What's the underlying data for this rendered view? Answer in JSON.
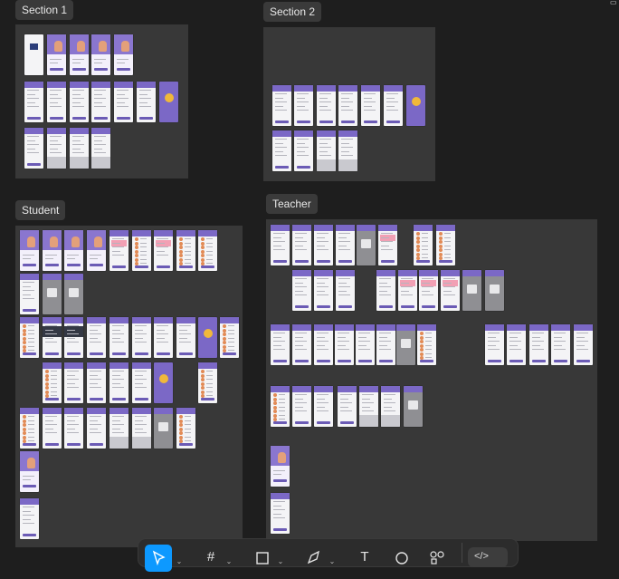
{
  "canvas": {
    "sections": [
      {
        "label": "Section 1"
      },
      {
        "label": "Section 2"
      },
      {
        "label": "Student"
      },
      {
        "label": "Teacher"
      }
    ]
  },
  "toolbar": {
    "tools": [
      {
        "name": "move-tool",
        "icon": "cursor-arrow-icon",
        "active": true
      },
      {
        "name": "frame-tool",
        "icon": "frame-hash-icon"
      },
      {
        "name": "shape-tool",
        "icon": "rectangle-icon"
      },
      {
        "name": "pen-tool",
        "icon": "pen-icon"
      },
      {
        "name": "text-tool",
        "icon": "text-t-icon"
      },
      {
        "name": "comment-tool",
        "icon": "comment-bubble-icon"
      },
      {
        "name": "actions-tool",
        "icon": "components-icon"
      }
    ],
    "dev_mode_label": "</>"
  },
  "colors": {
    "canvas_bg": "#1e1e1e",
    "section_bg": "#383838",
    "accent_purple": "#7b68c6",
    "active_tool": "#0d99ff"
  }
}
